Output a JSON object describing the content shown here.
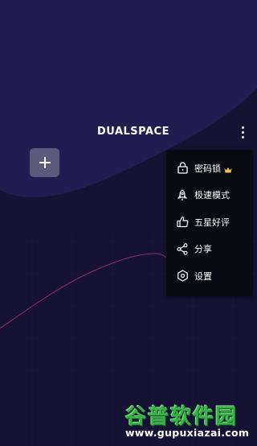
{
  "header": {
    "logo_text": "DUALSPACE",
    "more_icon": "more-vertical-icon"
  },
  "add_button": {
    "icon": "plus-icon"
  },
  "menu": {
    "items": [
      {
        "label": "密码锁",
        "icon": "lock-icon",
        "badge_icon": "crown-icon",
        "badge_color": "#f3c34b"
      },
      {
        "label": "极速模式",
        "icon": "rocket-icon"
      },
      {
        "label": "五星好评",
        "icon": "thumbs-up-icon"
      },
      {
        "label": "分享",
        "icon": "share-icon"
      },
      {
        "label": "设置",
        "icon": "settings-icon"
      }
    ]
  },
  "watermark": {
    "title": "谷普软件园",
    "url": "www.gupuxiazai.com"
  },
  "colors": {
    "background": "#151233",
    "upper_panel": "#231f52",
    "menu_bg": "#0a0a12",
    "add_button_bg": "#5c5a7c",
    "accent_line": "#c2447a",
    "watermark_green": "#3dae4a"
  }
}
